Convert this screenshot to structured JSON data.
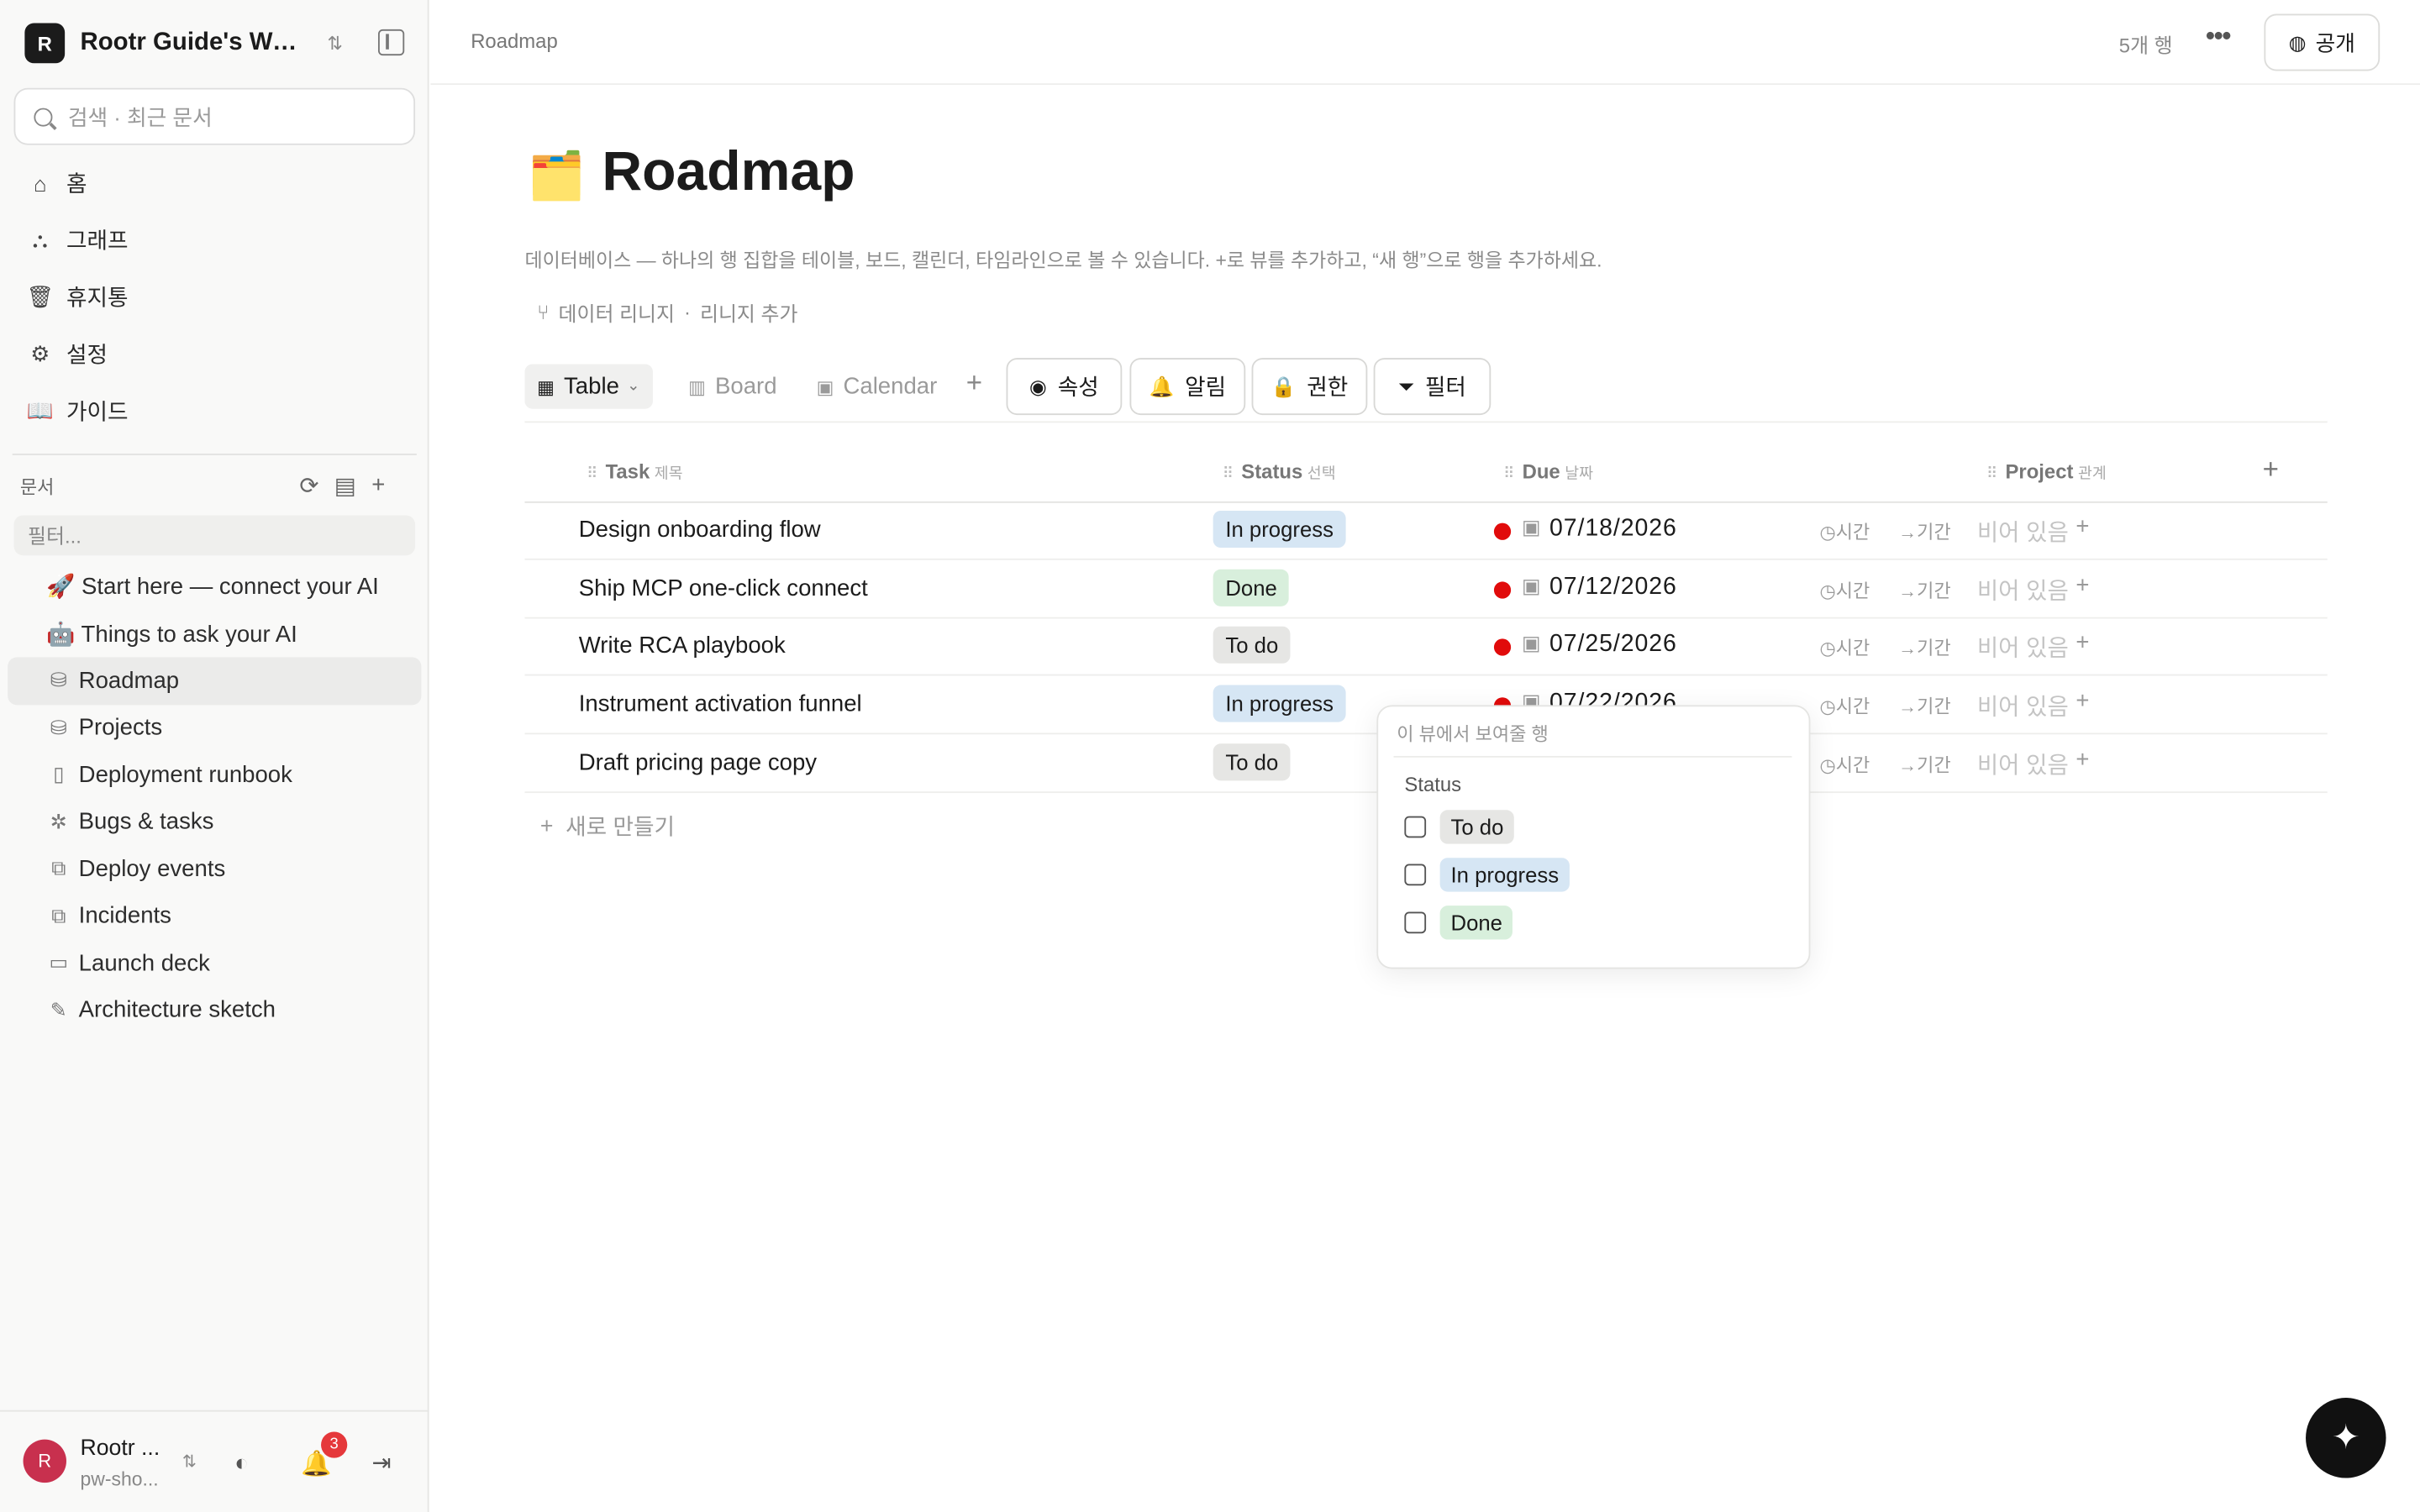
{
  "sidebar": {
    "workspace_initial": "R",
    "workspace_name": "Rootr Guide's Workspace",
    "search_placeholder": "검색 · 최근 문서",
    "nav": [
      {
        "label": "홈",
        "icon": "home-icon"
      },
      {
        "label": "그래프",
        "icon": "graph-icon"
      },
      {
        "label": "휴지통",
        "icon": "trash-icon"
      },
      {
        "label": "설정",
        "icon": "gear-icon"
      },
      {
        "label": "가이드",
        "icon": "book-icon"
      }
    ],
    "docs_label": "문서",
    "filter_placeholder": "필터...",
    "docs": [
      {
        "label": "🚀 Start here — connect your AI",
        "icon": "rocket-icon"
      },
      {
        "label": "🤖 Things to ask your AI",
        "icon": "robot-icon"
      },
      {
        "label": "Roadmap",
        "icon": "database-icon"
      },
      {
        "label": "Projects",
        "icon": "database-icon"
      },
      {
        "label": "Deployment runbook",
        "icon": "page-icon"
      },
      {
        "label": "Bugs & tasks",
        "icon": "bug-icon"
      },
      {
        "label": "Deploy events",
        "icon": "scroll-icon"
      },
      {
        "label": "Incidents",
        "icon": "scroll-icon"
      },
      {
        "label": "Launch deck",
        "icon": "presentation-icon"
      },
      {
        "label": "Architecture sketch",
        "icon": "pencil-icon"
      }
    ],
    "user": {
      "initial": "R",
      "name": "Rootr ...",
      "email": "pw-sho...",
      "notification_count": "3"
    }
  },
  "topbar": {
    "breadcrumb": "Roadmap",
    "row_count": "5개 행",
    "public_label": "공개"
  },
  "page": {
    "emoji": "🗂️",
    "title": "Roadmap",
    "description": "데이터베이스 — 하나의 행 집합을 테이블, 보드, 캘린더, 타임라인으로 볼 수 있습니다. +로 뷰를 추가하고, “새 행”으로 행을 추가하세요.",
    "lineage_label": "데이터 리니지",
    "lineage_add": "리니지 추가"
  },
  "views": {
    "tabs": [
      "Table",
      "Board",
      "Calendar"
    ],
    "tools": [
      "속성",
      "알림",
      "권한",
      "필터"
    ]
  },
  "table": {
    "columns": [
      {
        "name": "Task",
        "type": "제목"
      },
      {
        "name": "Status",
        "type": "선택"
      },
      {
        "name": "Due",
        "type": "날짜"
      },
      {
        "name": "Project",
        "type": "관계"
      }
    ],
    "time_label": "시간",
    "range_label": "기간",
    "empty_label": "비어 있음",
    "rows": [
      {
        "task": "Design onboarding flow",
        "status": "In progress",
        "due": "07/18/2026"
      },
      {
        "task": "Ship MCP one-click connect",
        "status": "Done",
        "due": "07/12/2026"
      },
      {
        "task": "Write RCA playbook",
        "status": "To do",
        "due": "07/25/2026"
      },
      {
        "task": "Instrument activation funnel",
        "status": "In progress",
        "due": "07/22/2026"
      },
      {
        "task": "Draft pricing page copy",
        "status": "To do",
        "due": ""
      }
    ],
    "new_row_label": "새로 만들기"
  },
  "popover": {
    "title": "이 뷰에서 보여줄 행",
    "group": "Status",
    "options": [
      "To do",
      "In progress",
      "Done"
    ]
  },
  "colors": {
    "in_progress": "#d6e6f4",
    "done": "#d8efdc",
    "todo": "#e6e6e4",
    "due_dot": "#e10b0b",
    "avatar": "#c8304e"
  }
}
